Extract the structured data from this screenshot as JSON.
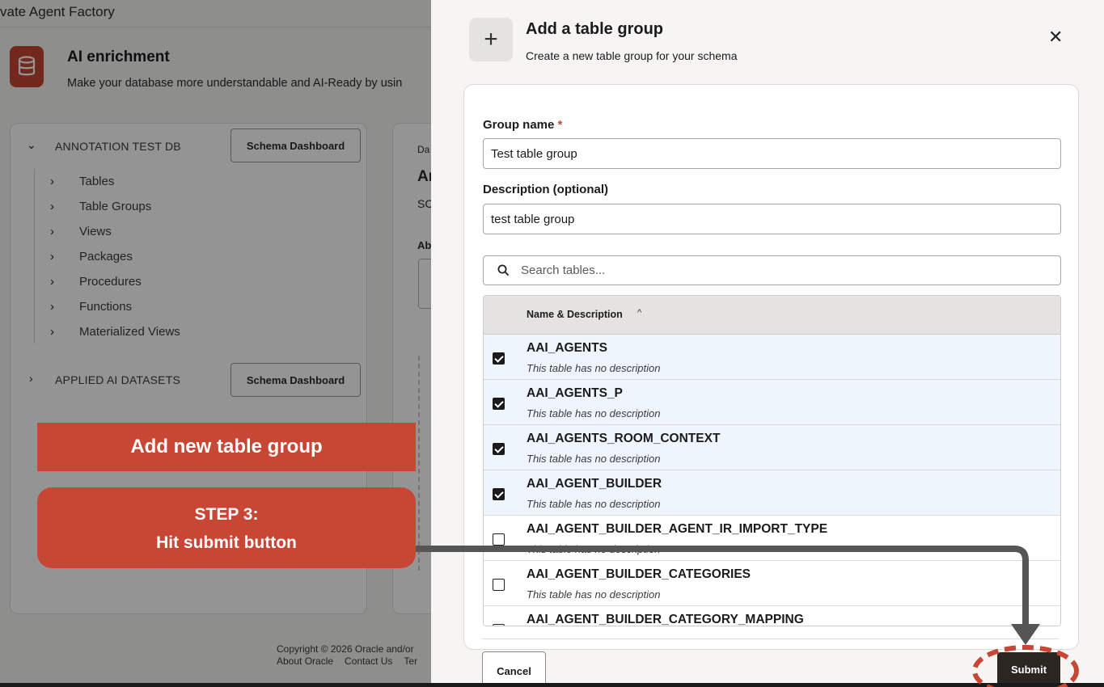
{
  "app": {
    "title": "vate Agent Factory"
  },
  "header": {
    "title": "AI enrichment",
    "subtitle": "Make your database more understandable and AI-Ready by usin"
  },
  "tree": {
    "db1": {
      "name": "ANNOTATION TEST DB",
      "button": "Schema Dashboard"
    },
    "items": [
      "Tables",
      "Table Groups",
      "Views",
      "Packages",
      "Procedures",
      "Functions",
      "Materialized Views"
    ],
    "db2": {
      "name": "APPLIED AI DATASETS",
      "button": "Schema Dashboard"
    }
  },
  "detail_peek": {
    "l1": "Da",
    "l2": "Ar",
    "l3": "SC",
    "l4": "Ab"
  },
  "footer": {
    "copyright": "Copyright © 2026 Oracle and/or",
    "links": [
      "About Oracle",
      "Contact Us",
      "Ter"
    ]
  },
  "dialog": {
    "title": "Add a table group",
    "subtitle": "Create a new table group for your schema",
    "group_name_label": "Group name",
    "required_mark": "*",
    "group_name_value": "Test table group",
    "description_label": "Description (optional)",
    "description_value": "test table group",
    "search_placeholder": "Search tables...",
    "table_header": "Name & Description",
    "sort_indicator": "^",
    "rows": [
      {
        "name": "AAI_AGENTS",
        "desc": "This table has no description",
        "checked": true
      },
      {
        "name": "AAI_AGENTS_P",
        "desc": "This table has no description",
        "checked": true
      },
      {
        "name": "AAI_AGENTS_ROOM_CONTEXT",
        "desc": "This table has no description",
        "checked": true
      },
      {
        "name": "AAI_AGENT_BUILDER",
        "desc": "This table has no description",
        "checked": true
      },
      {
        "name": "AAI_AGENT_BUILDER_AGENT_IR_IMPORT_TYPE",
        "desc": "This table has no description",
        "checked": false
      },
      {
        "name": "AAI_AGENT_BUILDER_CATEGORIES",
        "desc": "This table has no description",
        "checked": false
      },
      {
        "name": "AAI_AGENT_BUILDER_CATEGORY_MAPPING",
        "desc": "",
        "checked": false
      }
    ],
    "cancel_label": "Cancel",
    "submit_label": "Submit"
  },
  "tutorial": {
    "banner": "Add new table group",
    "step_title": "STEP 3:",
    "step_text": "Hit submit button",
    "accent_color": "#c74634"
  },
  "colors": {
    "brand_red": "#c74634",
    "submit_bg": "#2b2622",
    "selected_row": "#eef5fd"
  }
}
